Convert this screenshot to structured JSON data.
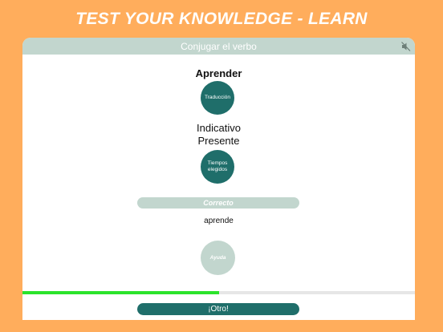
{
  "banner": {
    "text": "TEST YOUR KNOWLEDGE - LEARN"
  },
  "header": {
    "title": "Conjugar el verbo",
    "mute_icon": "speaker-muted-icon"
  },
  "quiz": {
    "verb": "Aprender",
    "translation_button": "Traducción",
    "mood": "Indicativo",
    "tense": "Presente",
    "tenses_button": "Tiempos elegidos",
    "result": "Correcto",
    "answer": "aprende",
    "help_button": "Ayuda"
  },
  "progress": {
    "fraction": 0.5
  },
  "footer": {
    "next_button": "¡Otro!"
  },
  "colors": {
    "background": "#FFAD5C",
    "header": "#C2D6CE",
    "accent": "#1F6E6A",
    "muted": "#C2D6CE",
    "progress": "#2BE32B"
  }
}
